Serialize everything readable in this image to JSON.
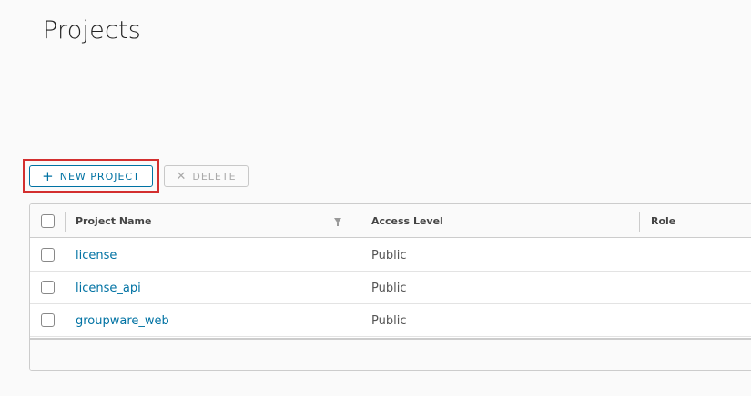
{
  "page": {
    "title": "Projects"
  },
  "toolbar": {
    "new_project_label": "NEW PROJECT",
    "delete_label": "DELETE",
    "highlight_color": "#d32f2f",
    "accent_color": "#0072a3"
  },
  "table": {
    "columns": [
      "Project Name",
      "Access Level",
      "Role"
    ],
    "rows": [
      {
        "name": "license",
        "access": "Public",
        "role": ""
      },
      {
        "name": "license_api",
        "access": "Public",
        "role": ""
      },
      {
        "name": "groupware_web",
        "access": "Public",
        "role": ""
      }
    ]
  },
  "icons": {
    "new_project": "plus-icon",
    "delete": "close-icon",
    "filter": "filter-icon"
  }
}
